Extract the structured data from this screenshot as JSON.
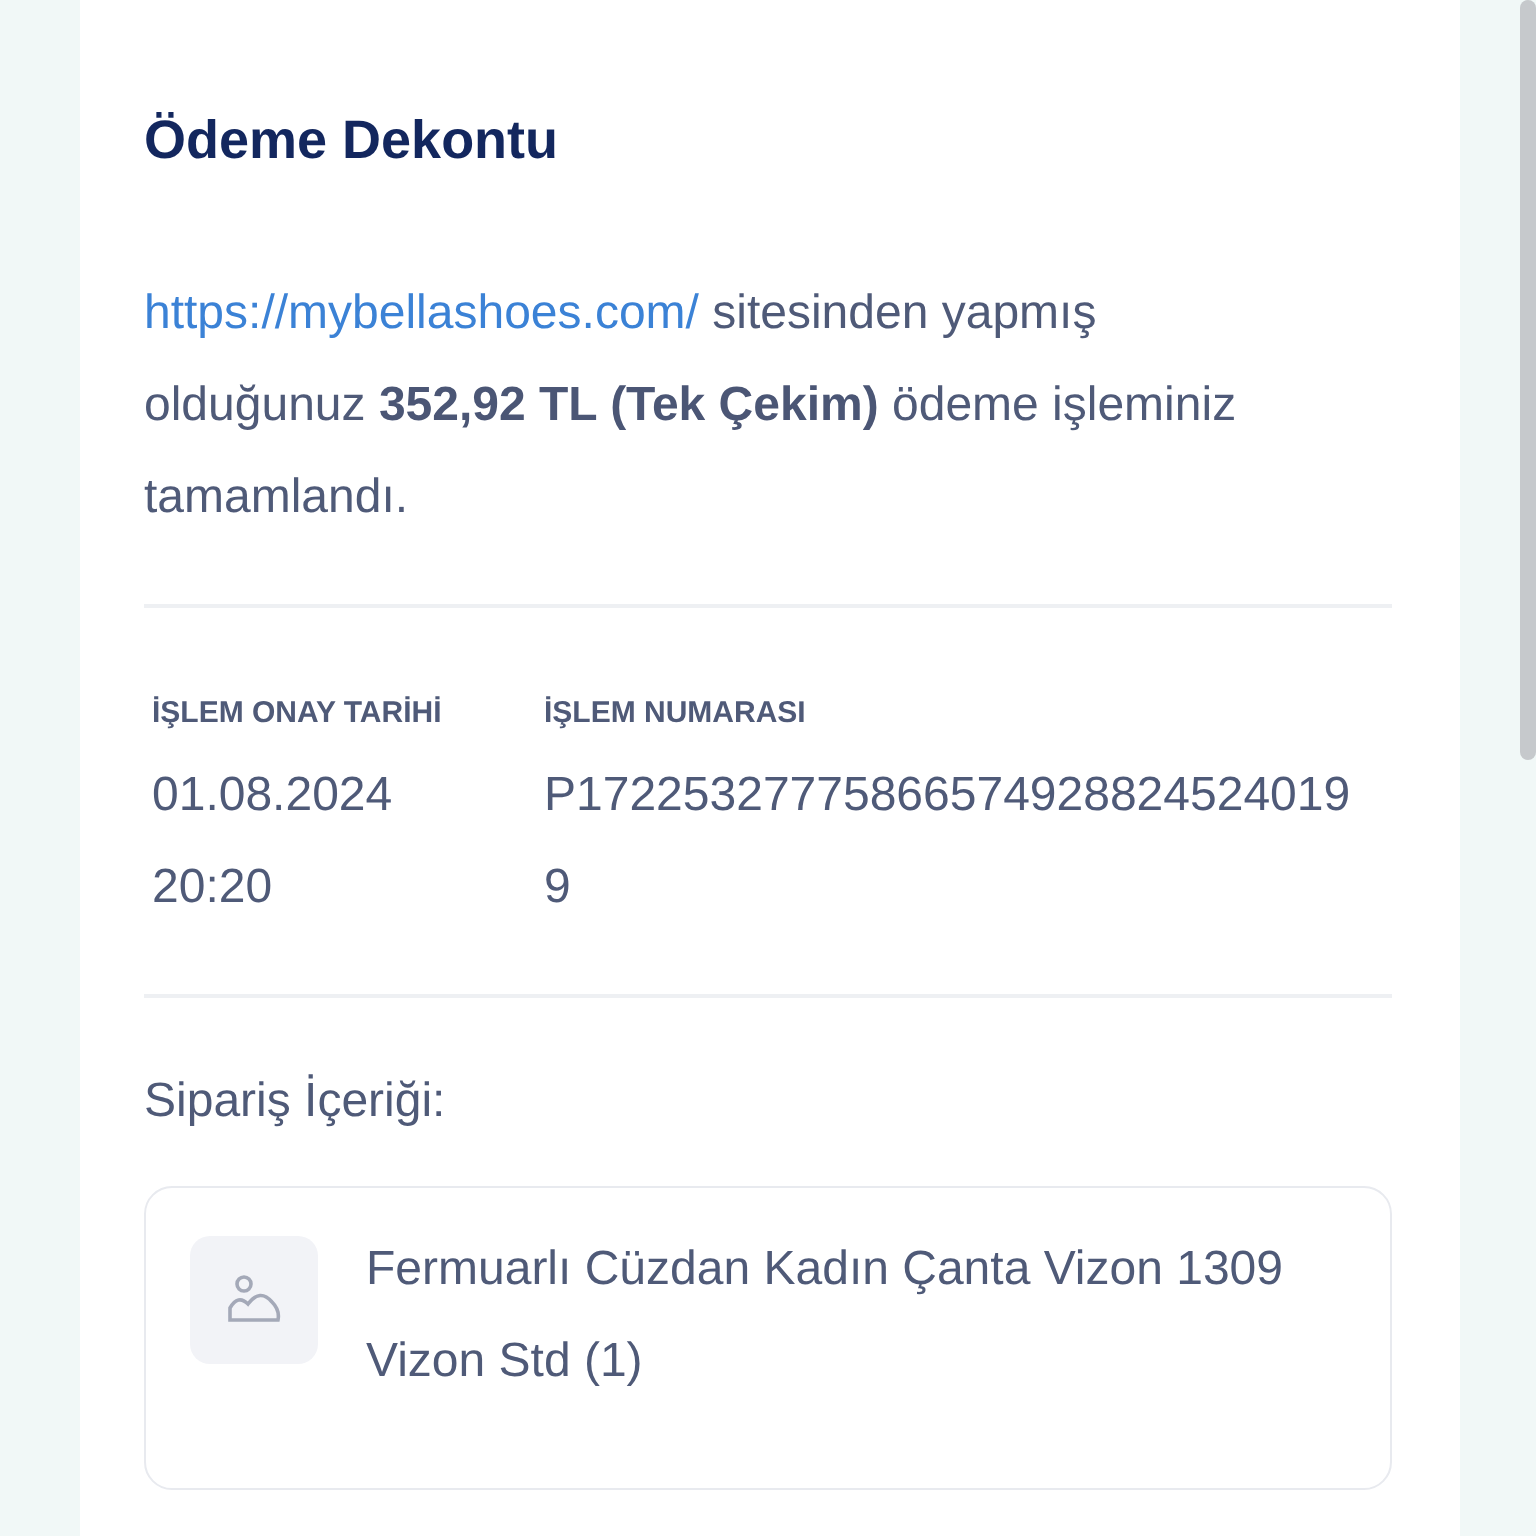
{
  "title": "Ödeme Dekontu",
  "link": "https://mybellashoes.com/",
  "message_rest": "sitesinden yapmış olduğunuz **352,92 TL (Tek Çekim)** ödeme işleminiz tamamlandı.",
  "details": [
    {
      "label": "İŞLEM ONAY TARİHİ",
      "value": "01.08.2024 20:20"
    },
    {
      "label": "İŞLEM NUMARASI",
      "value": "P17225327775866574928824524019 9"
    }
  ],
  "order_heading": "Sipariş İçeriği:",
  "order_items": [
    {
      "kind": "picture",
      "name": "Fermuarlı Cüzdan Kadın Çanta Vizon 1309 Vizon Std (1)"
    }
  ]
}
